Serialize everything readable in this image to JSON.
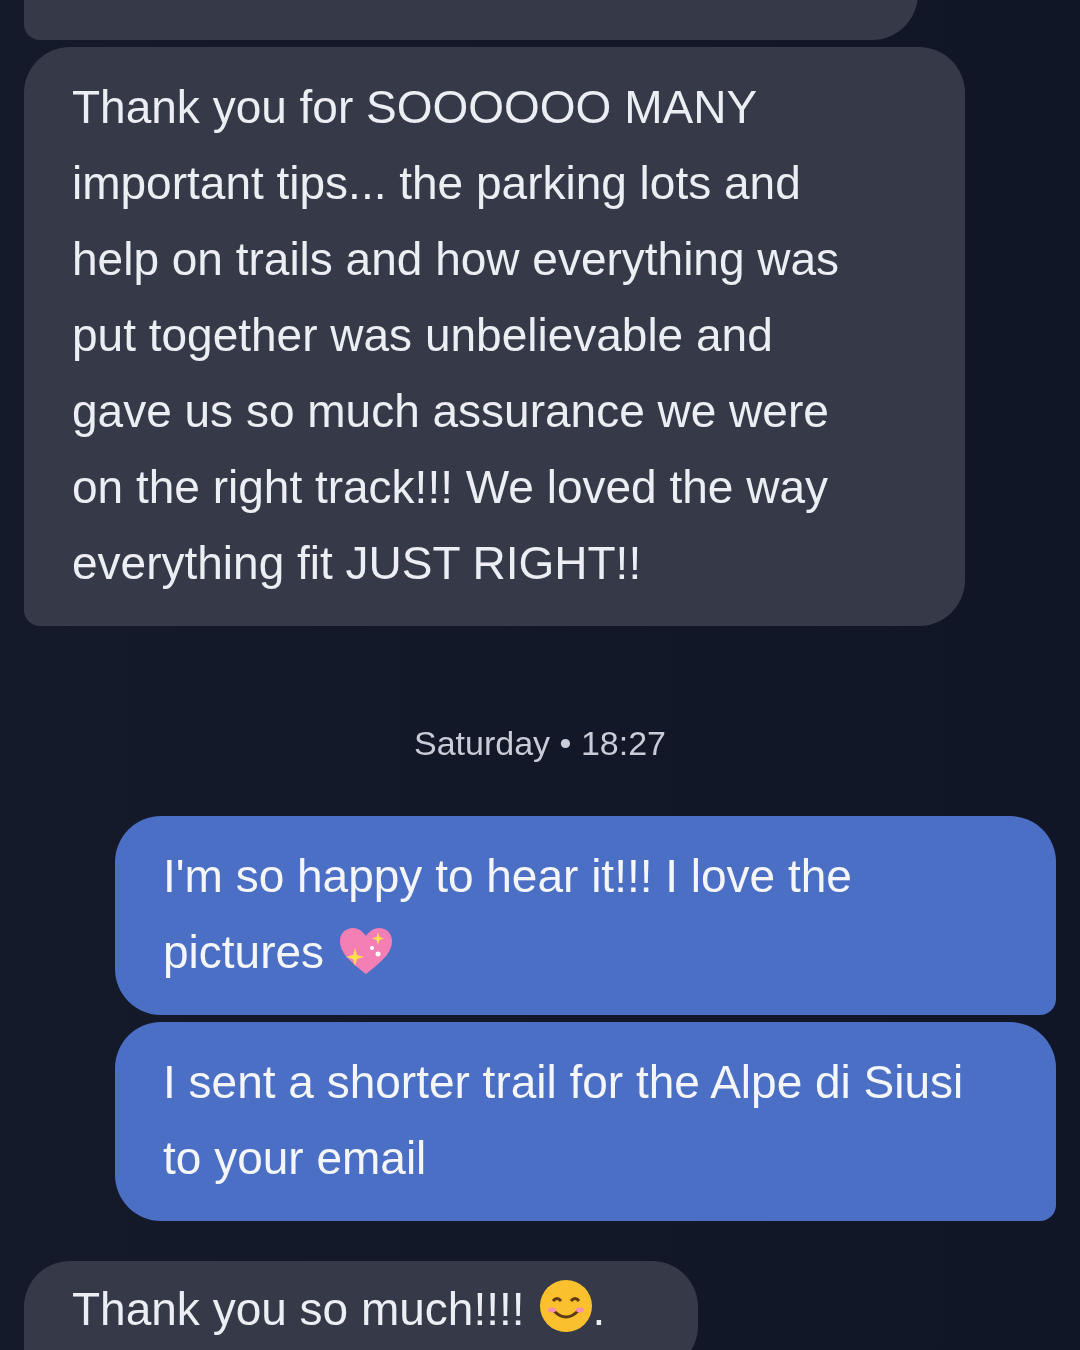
{
  "messages": [
    {
      "kind": "partial"
    },
    {
      "kind": "received",
      "text": "Thank you for SOOOOOO MANY important tips... the parking lots and help on trails and how everything was put together was unbelievable and gave us so much assurance we were on the right track!!! We loved the way everything fit JUST RIGHT!!"
    },
    {
      "kind": "timestamp",
      "day": "Saturday",
      "separator": "•",
      "time": "18:27"
    },
    {
      "kind": "sent",
      "text": "I'm so happy to hear it!!! I love the pictures",
      "has_emoji": true
    },
    {
      "kind": "sent",
      "text": "I sent a shorter trail for the Alpe di Siusi to your email",
      "has_emoji": false
    },
    {
      "kind": "received",
      "text": "Thank you so much!!!!",
      "has_emoji": true,
      "text_after": "."
    }
  ]
}
